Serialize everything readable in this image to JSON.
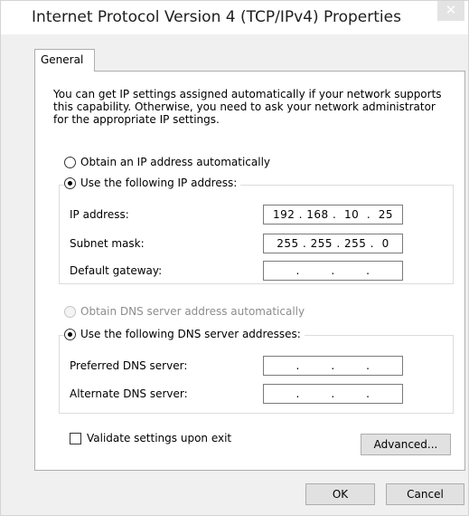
{
  "window": {
    "title": "Internet Protocol Version 4 (TCP/IPv4) Properties",
    "close_glyph": "✕"
  },
  "tabs": [
    {
      "label": "General"
    }
  ],
  "intro_text": "You can get IP settings assigned automatically if your network supports this capability. Otherwise, you need to ask your network administrator for the appropriate IP settings.",
  "ip_section": {
    "auto_label": "Obtain an IP address automatically",
    "manual_label": "Use the following IP address:",
    "fields": [
      {
        "label": "IP address:",
        "value": "192 . 168 .  10  .  25"
      },
      {
        "label": "Subnet mask:",
        "value": "255 . 255 . 255 .  0"
      },
      {
        "label": "Default gateway:",
        "value": "   .        .        .   "
      }
    ]
  },
  "dns_section": {
    "auto_label": "Obtain DNS server address automatically",
    "manual_label": "Use the following DNS server addresses:",
    "fields": [
      {
        "label": "Preferred DNS server:",
        "value": "   .        .        .   "
      },
      {
        "label": "Alternate DNS server:",
        "value": "   .        .        .   "
      }
    ]
  },
  "validate_label": "Validate settings upon exit",
  "buttons": {
    "advanced": "Advanced...",
    "ok": "OK",
    "cancel": "Cancel"
  }
}
